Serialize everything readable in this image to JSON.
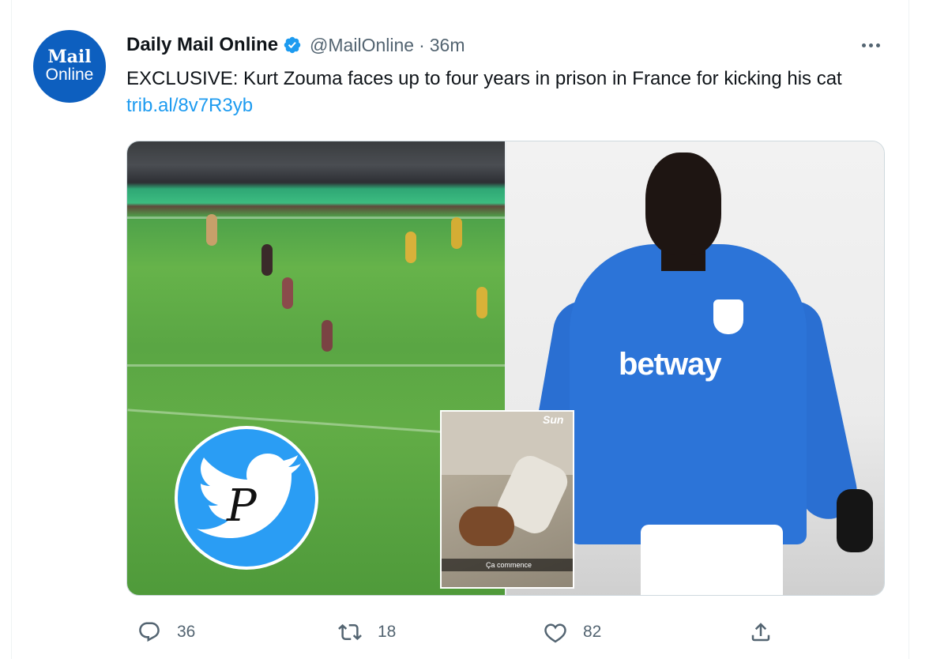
{
  "tweet": {
    "author": {
      "avatar_line1": "Mail",
      "avatar_line2": "Online",
      "name": "Daily Mail Online",
      "handle": "@MailOnline",
      "separator": "·",
      "time": "36m"
    },
    "text": {
      "body": "EXCLUSIVE: Kurt Zouma faces up to four years in prison in France for kicking his cat ",
      "link": "trib.al/8v7R3yb"
    },
    "media": {
      "sponsor_text": "betway",
      "inset_brand": "Sun",
      "inset_caption": "Ça commence"
    },
    "actions": {
      "replies": "36",
      "retweets": "18",
      "likes": "82"
    },
    "icons": {
      "verified": "verified-badge-icon",
      "more": "more-options-icon",
      "reply": "reply-icon",
      "retweet": "retweet-icon",
      "like": "heart-icon",
      "share": "share-icon",
      "watermark": "twitter-bird-watermark-icon"
    },
    "colors": {
      "link": "#1d9bf0",
      "verified": "#1d9bf0",
      "secondary_text": "#536471",
      "avatar_bg": "#0d5fbf",
      "watermark_bg": "#2a9df4"
    }
  }
}
